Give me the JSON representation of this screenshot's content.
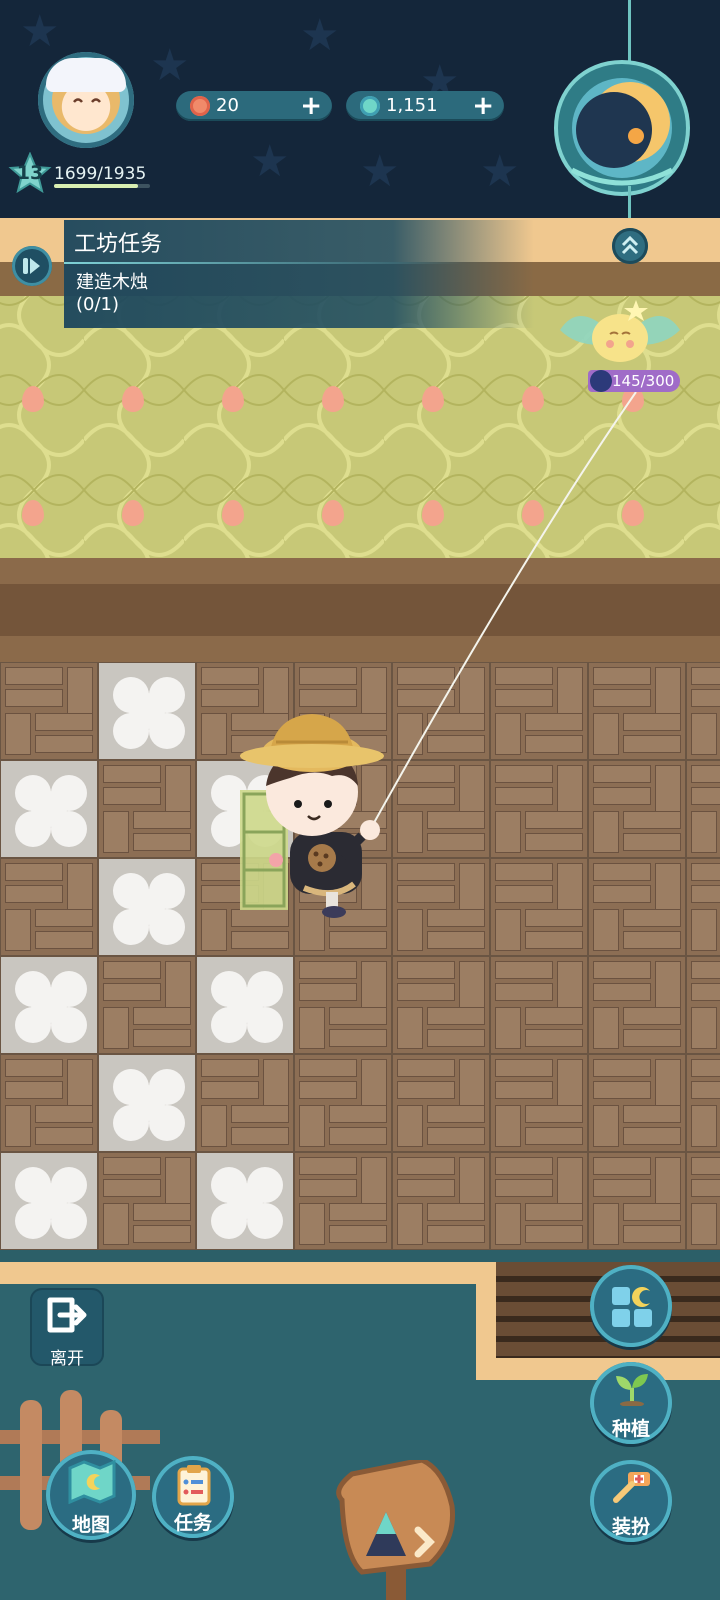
{
  "player": {
    "level": "13",
    "xp": "1699/1935",
    "xp_fraction": 0.878
  },
  "currencies": {
    "coins": "20",
    "gems": "1,151"
  },
  "quest": {
    "title": "工坊任务",
    "description": "建造木烛",
    "progress": "(0/1)"
  },
  "kite": {
    "progress": "145/300"
  },
  "buttons": {
    "leave": "离开",
    "map": "地图",
    "tasks": "任务",
    "plant": "种植",
    "dressup": "装扮"
  },
  "colors": {
    "hud_bg": "#14263a",
    "accent_teal": "#4fb1c4",
    "wallpaper": "#c7c877",
    "floor_wood": "#8c6e54"
  }
}
